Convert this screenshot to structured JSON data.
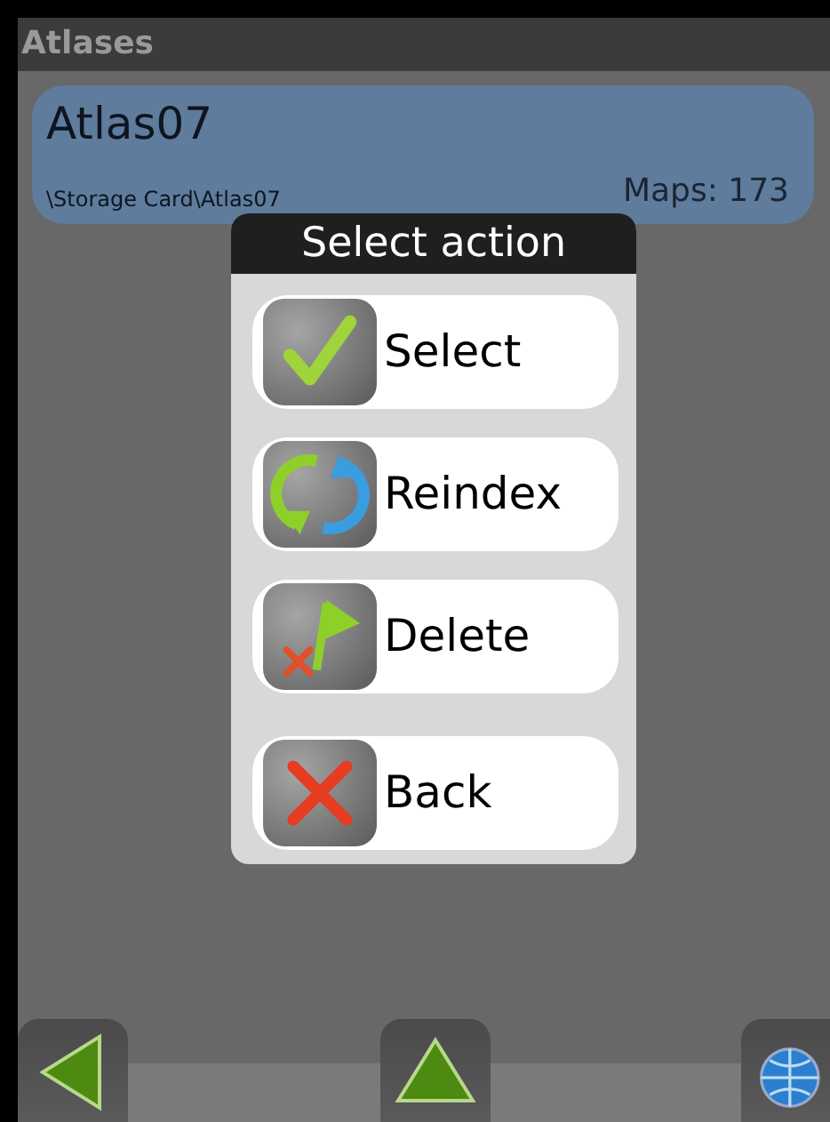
{
  "title_bar": {
    "title": "Atlases"
  },
  "atlas": {
    "name": "Atlas07",
    "path": "\\Storage Card\\Atlas07",
    "maps": "Maps: 173"
  },
  "dialog": {
    "title": "Select action",
    "actions": [
      {
        "kind": "select",
        "label": "Select"
      },
      {
        "kind": "reindex",
        "label": "Reindex"
      },
      {
        "kind": "delete",
        "label": "Delete"
      },
      {
        "kind": "back",
        "label": "Back"
      }
    ]
  },
  "toolbar": [
    {
      "kind": "back"
    },
    {
      "kind": "up"
    },
    {
      "kind": "globe"
    }
  ]
}
